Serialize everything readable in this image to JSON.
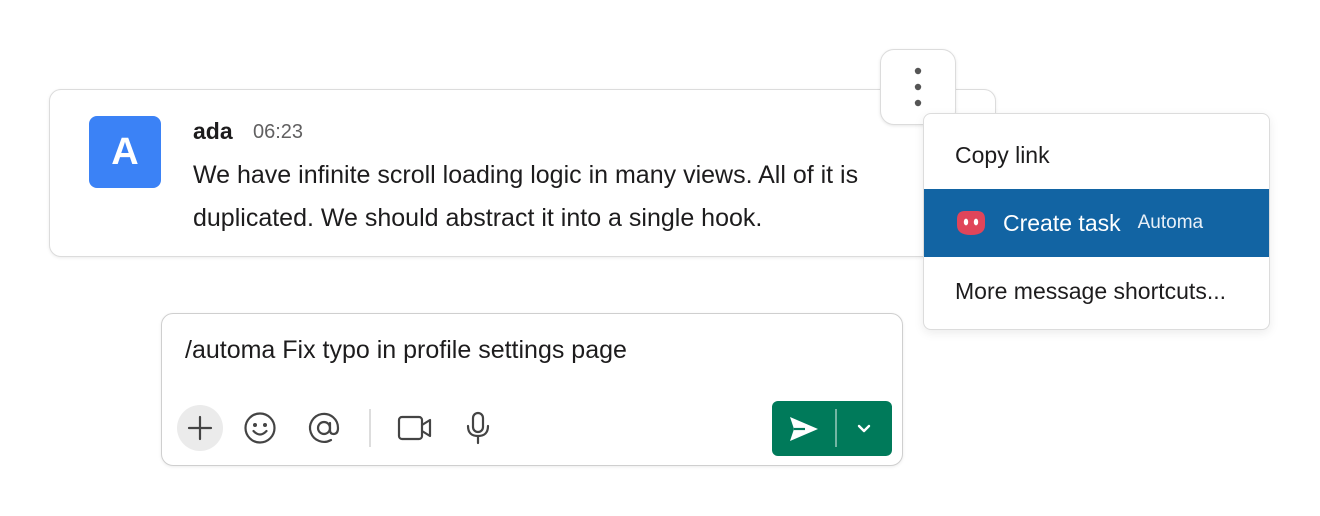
{
  "message": {
    "avatar_letter": "A",
    "author": "ada",
    "time": "06:23",
    "text": "We have infinite scroll loading logic in many views. All of it is duplicated. We should abstract it into a single hook."
  },
  "context_menu": {
    "items": [
      {
        "label": "Copy link"
      },
      {
        "label": "Create task",
        "app": "Automa",
        "icon": "automa-app-icon",
        "highlighted": true
      },
      {
        "label": "More message shortcuts..."
      }
    ]
  },
  "composer": {
    "text": "/automa Fix typo in profile settings page",
    "tools": [
      "plus-icon",
      "emoji-icon",
      "mention-icon",
      "video-icon",
      "microphone-icon"
    ]
  },
  "colors": {
    "avatar": "#3b82f6",
    "menu_highlight": "#1264a3",
    "send": "#007a5a",
    "automa_icon": "#e0455a"
  }
}
